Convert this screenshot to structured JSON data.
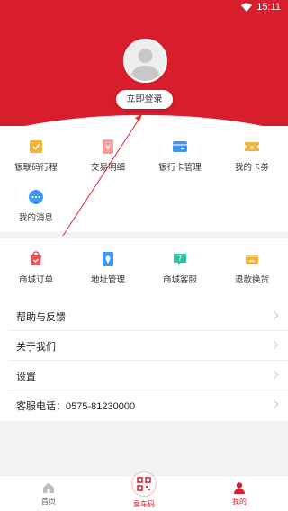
{
  "status_bar": {
    "time": "15:11"
  },
  "profile": {
    "login_label": "立即登录"
  },
  "grid_top": [
    {
      "label": "银联码行程",
      "icon": "transit-receipt-icon"
    },
    {
      "label": "交易明细",
      "icon": "transaction-detail-icon"
    },
    {
      "label": "银行卡管理",
      "icon": "bank-card-icon"
    },
    {
      "label": "我的卡劵",
      "icon": "coupon-icon"
    },
    {
      "label": "我的消息",
      "icon": "message-icon"
    }
  ],
  "grid_shop": [
    {
      "label": "商城订单",
      "icon": "shop-order-icon"
    },
    {
      "label": "地址管理",
      "icon": "address-pin-icon"
    },
    {
      "label": "商城客服",
      "icon": "customer-service-icon"
    },
    {
      "label": "退款换货",
      "icon": "refund-icon"
    }
  ],
  "menu": [
    {
      "label": "帮助与反馈"
    },
    {
      "label": "关于我们"
    },
    {
      "label": "设置"
    },
    {
      "label": "客服电话：0575-81230000"
    }
  ],
  "tabs": {
    "home": "首页",
    "scan": "乘车码",
    "mine": "我的"
  },
  "colors": {
    "brand": "#d81e2c",
    "icon_gold": "#f0b23a",
    "icon_pink": "#f3a09a",
    "icon_blue": "#3e98f0",
    "icon_green": "#2ec2a4"
  }
}
